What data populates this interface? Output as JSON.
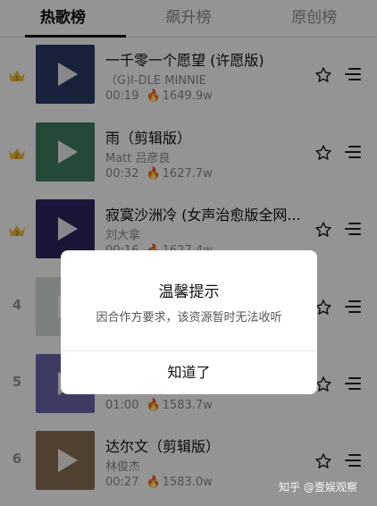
{
  "tabs": [
    {
      "label": "热歌榜"
    },
    {
      "label": "飙升榜"
    },
    {
      "label": "原创榜"
    }
  ],
  "songs": [
    {
      "rank": "",
      "crown": "crown-icon",
      "title": "一千零一个愿望 (许愿版)",
      "artist": "（G)I-DLE MINNIE",
      "duration": "00:19",
      "plays": "1649.9w",
      "cover_color": "#2a3b66"
    },
    {
      "rank": "",
      "crown": "crown-icon",
      "title": "雨（剪辑版）",
      "artist": "Matt 吕彦良",
      "duration": "00:32",
      "plays": "1627.7w",
      "cover_color": "#3f7f5e"
    },
    {
      "rank": "",
      "crown": "crown-icon",
      "title": "寂寞沙洲冷 (女声治愈版全网...",
      "artist": "刘大拿",
      "duration": "00:16",
      "plays": "1627.4w",
      "cover_color": "#2c2760"
    },
    {
      "rank": "4",
      "title": "",
      "artist": "",
      "duration": "",
      "plays": "",
      "cover_color": "#d8ded8"
    },
    {
      "rank": "5",
      "title": "",
      "artist": "",
      "duration": "01:00",
      "plays": "1583.7w",
      "cover_color": "#6a66a8"
    },
    {
      "rank": "6",
      "title": "达尔文（剪辑版）",
      "artist": "林俊杰",
      "duration": "00:27",
      "plays": "1583.0w",
      "cover_color": "#8a7058"
    }
  ],
  "dialog": {
    "title": "温馨提示",
    "message": "因合作方要求，该资源暂时无法收听",
    "button": "知道了"
  },
  "watermark": "知乎 @壹娱观察",
  "colors": {
    "crown": "#f1bd3a",
    "overlay": "rgba(0,0,0,0.42)"
  }
}
